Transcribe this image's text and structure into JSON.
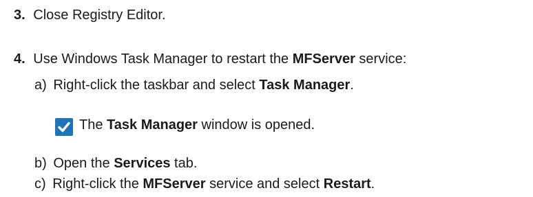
{
  "steps": {
    "step3": {
      "number": "3.",
      "text": "Close Registry Editor."
    },
    "step4": {
      "number": "4.",
      "text_before": "Use Windows Task Manager to restart the ",
      "bold": "MFServer",
      "text_after": " service:",
      "substeps": {
        "a": {
          "marker": "a)",
          "text_before": "Right-click the taskbar and select ",
          "bold": "Task Manager",
          "text_after": "."
        },
        "result": {
          "icon": "checkmark-icon",
          "text_before": "The ",
          "bold": "Task Manager",
          "text_after": " window is opened."
        },
        "b": {
          "marker": "b)",
          "text_before": "Open the ",
          "bold": "Services",
          "text_after": " tab."
        },
        "c": {
          "marker": "c)",
          "text_before": "Right-click the ",
          "bold": "MFServer",
          "text_middle": " service and select ",
          "bold2": "Restart",
          "text_after": "."
        }
      }
    }
  },
  "colors": {
    "checkmark_bg": "#1e73b9",
    "text": "#1a1a1a"
  }
}
